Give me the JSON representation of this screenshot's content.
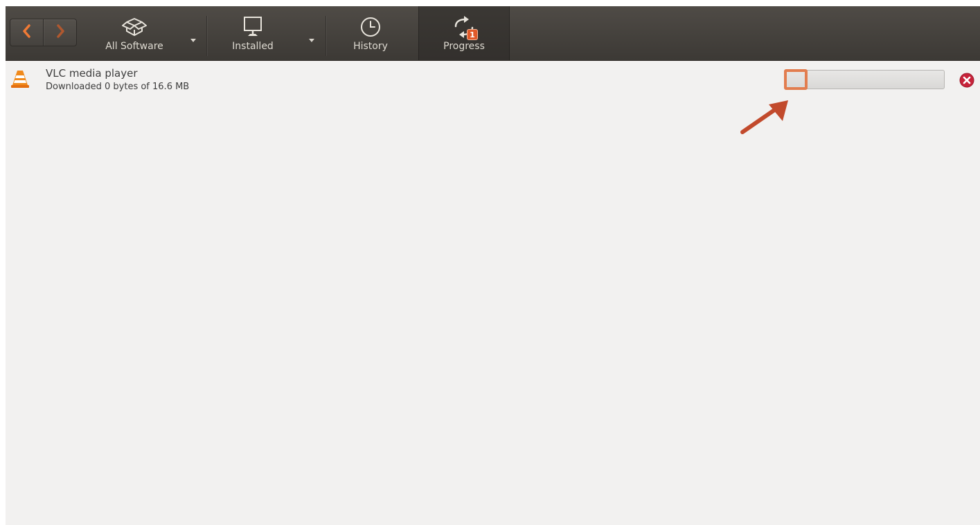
{
  "toolbar": {
    "nav": {
      "back_icon": "chevron-left-icon",
      "forward_icon": "chevron-right-icon"
    },
    "buttons": [
      {
        "label": "All Software",
        "icon": "open-box-icon"
      },
      {
        "label": "Installed",
        "icon": "monitor-icon"
      },
      {
        "label": "History",
        "icon": "clock-icon"
      },
      {
        "label": "Progress",
        "icon": "sync-arrows-icon",
        "badge": "1"
      }
    ]
  },
  "progress_list": {
    "items": [
      {
        "name": "VLC media player",
        "status": "Downloaded 0 bytes of 16.6 MB",
        "icon": "vlc-cone-icon",
        "progress_percent": 0
      }
    ]
  },
  "colors": {
    "toolbar_bg": "#46423e",
    "content_bg": "#f2f1f0",
    "accent_orange": "#e27d4f",
    "annotation_arrow": "#c24a2c",
    "badge_bg": "#e05a2a",
    "cancel_red": "#c7233a"
  }
}
